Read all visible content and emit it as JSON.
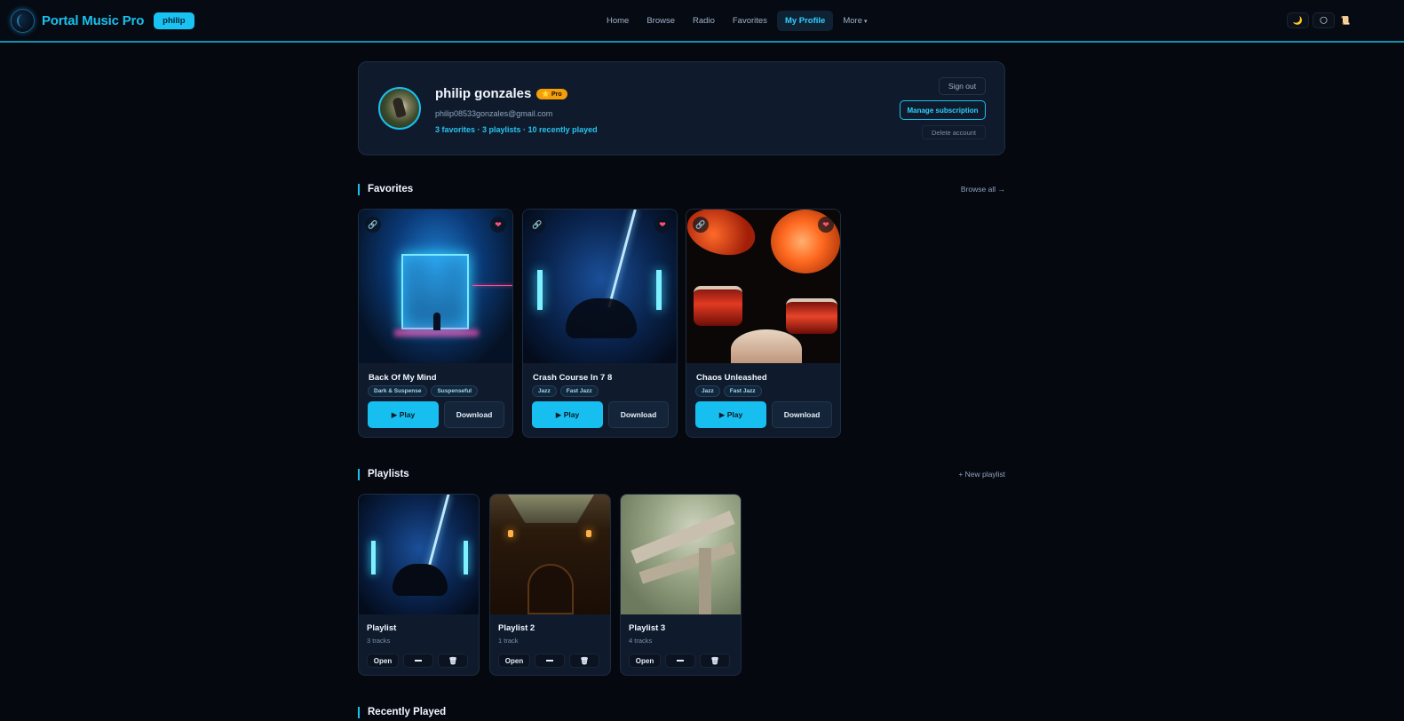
{
  "header": {
    "brand": "Portal Music Pro",
    "user_chip": "philip",
    "nav": [
      {
        "label": "Home",
        "active": false
      },
      {
        "label": "Browse",
        "active": false
      },
      {
        "label": "Radio",
        "active": false
      },
      {
        "label": "Favorites",
        "active": false
      },
      {
        "label": "My Profile",
        "active": true
      },
      {
        "label": "More",
        "active": false
      }
    ],
    "actions": {
      "moon": "🌙",
      "sun": "🌕",
      "notes": "📜"
    }
  },
  "profile": {
    "name": "philip gonzales",
    "badge": "⭐ Pro",
    "email": "philip08533gonzales@gmail.com",
    "stats": "3 favorites · 3 playlists · 10 recently played",
    "sign_out": "Sign out",
    "manage": "Manage subscription",
    "delete": "Delete account"
  },
  "favorites": {
    "title": "Favorites",
    "link": "Browse all →",
    "items": [
      {
        "title": "Back Of My Mind",
        "tags": [
          "Dark & Suspense",
          "Suspenseful"
        ],
        "play": "▶ Play",
        "download": "Download"
      },
      {
        "title": "Crash Course In 7 8",
        "tags": [
          "Jazz",
          "Fast Jazz"
        ],
        "play": "▶ Play",
        "download": "Download"
      },
      {
        "title": "Chaos Unleashed",
        "tags": [
          "Jazz",
          "Fast Jazz"
        ],
        "play": "▶ Play",
        "download": "Download"
      }
    ]
  },
  "playlists": {
    "title": "Playlists",
    "link": "+ New playlist",
    "items": [
      {
        "title": "Playlist",
        "count": "3 tracks",
        "open": "Open"
      },
      {
        "title": "Playlist 2",
        "count": "1 track",
        "open": "Open"
      },
      {
        "title": "Playlist 3",
        "count": "4 tracks",
        "open": "Open"
      }
    ]
  },
  "recent": {
    "title": "Recently Played"
  },
  "colors": {
    "accent": "#19c0ee",
    "pro": "#f59e0b",
    "background": "#05080f",
    "card": "#0f1b2c"
  }
}
